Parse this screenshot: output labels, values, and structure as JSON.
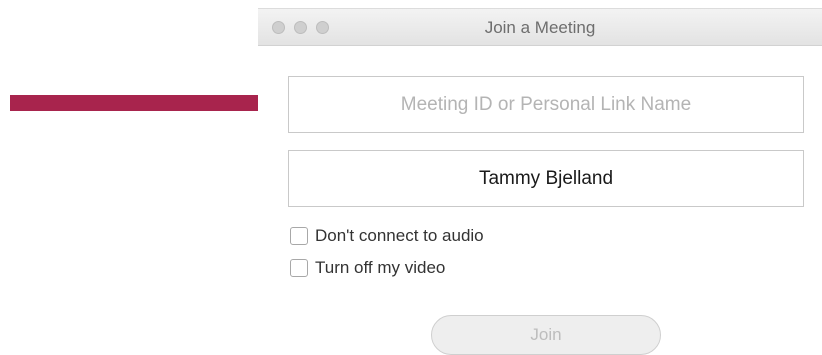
{
  "window": {
    "title": "Join a Meeting"
  },
  "form": {
    "meeting_id_placeholder": "Meeting ID or Personal Link Name",
    "meeting_id_value": "",
    "name_value": "Tammy Bjelland",
    "options": [
      {
        "label": "Don't connect to audio",
        "checked": false
      },
      {
        "label": "Turn off my video",
        "checked": false
      }
    ],
    "join_label": "Join"
  },
  "colors": {
    "annotation_arrow": "#a8244d",
    "disabled_text": "#bdbdbd",
    "placeholder": "#b4b4b4"
  },
  "icons": [
    "arrow-annotation-icon"
  ]
}
